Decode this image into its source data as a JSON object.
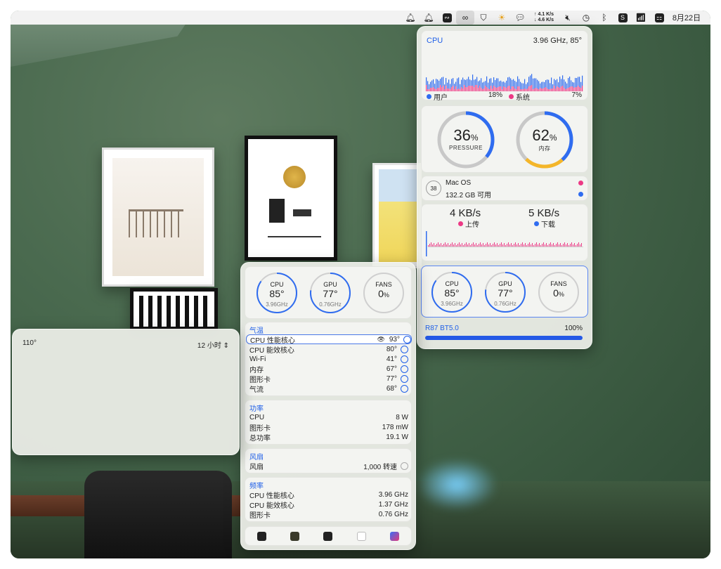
{
  "menubar": {
    "net_up": "4.1 K/s",
    "net_down": "4.6 K/s",
    "date": "8月22日",
    "icons": [
      "bell-icon",
      "bell-icon",
      "stats-app-icon",
      "link-icon",
      "shield-icon",
      "weather-icon",
      "wechat-icon",
      "network-speed",
      "mute-icon",
      "clock-icon",
      "bluetooth-icon",
      "s-app-icon",
      "wifi-icon",
      "control-center-icon"
    ]
  },
  "cpu": {
    "title": "CPU",
    "freq_temp": "3.96 GHz, 85°",
    "user_label": "用户",
    "user_pct": "18%",
    "sys_label": "系统",
    "sys_pct": "7%",
    "colors": {
      "user": "#2f6cf0",
      "system": "#ec3a86"
    }
  },
  "rings": {
    "pressure_value": "36",
    "pressure_label": "PRESSURE",
    "pressure_level": 0.36,
    "memory_value": "62",
    "memory_label": "内存",
    "memory_level": 0.62,
    "pct": "%"
  },
  "disk": {
    "badge": "38",
    "name": "Mac OS",
    "free": "132.2 GB 可用"
  },
  "network": {
    "up_value": "4 KB/s",
    "up_label": "上传",
    "down_value": "5 KB/s",
    "down_label": "下载"
  },
  "gauges": [
    {
      "label": "CPU",
      "value": "85°",
      "sub": "3.96GHz",
      "level": 0.85
    },
    {
      "label": "GPU",
      "value": "77°",
      "sub": "0.76GHz",
      "level": 0.77
    },
    {
      "label": "FANS",
      "value": "0",
      "unit": "%",
      "level": 0.0
    }
  ],
  "battery": {
    "name": "R87 BT5.0",
    "pct": "100%",
    "level": 1.0
  },
  "sensors": {
    "temp_title": "气温",
    "temps": [
      {
        "label": "CPU 性能核心",
        "value": "93°"
      },
      {
        "label": "CPU 能效核心",
        "value": "80°"
      },
      {
        "label": "Wi-Fi",
        "value": "41°"
      },
      {
        "label": "内存",
        "value": "67°"
      },
      {
        "label": "图形卡",
        "value": "77°"
      },
      {
        "label": "气流",
        "value": "68°"
      }
    ],
    "power_title": "功率",
    "power": [
      {
        "label": "CPU",
        "value": "8 W"
      },
      {
        "label": "图形卡",
        "value": "178 mW"
      },
      {
        "label": "总功率",
        "value": "19.1 W"
      }
    ],
    "fan_title": "风扇",
    "fans": [
      {
        "label": "风扇",
        "value": "1,000 转速"
      }
    ],
    "freq_title": "频率",
    "freq": [
      {
        "label": "CPU 性能核心",
        "value": "3.96 GHz"
      },
      {
        "label": "CPU 能效核心",
        "value": "1.37 GHz"
      },
      {
        "label": "图形卡",
        "value": "0.76 GHz"
      }
    ],
    "menu_dots": "⋮"
  },
  "history": {
    "max_label": "110°",
    "range_select": "12 小时"
  },
  "chart_data": {
    "type": "bar",
    "title": "",
    "ylim": [
      0,
      110
    ],
    "values": [
      0,
      0,
      0,
      0,
      0,
      0,
      0,
      0,
      0,
      0,
      0,
      0,
      0,
      0,
      0,
      0,
      0,
      0,
      0,
      0,
      0,
      0,
      0,
      0,
      0,
      0,
      0,
      0,
      0,
      0,
      0,
      0,
      0,
      0,
      0,
      0,
      0,
      0,
      0,
      0,
      0,
      0,
      0,
      0,
      0,
      0,
      0,
      0,
      0,
      0,
      0,
      0,
      0,
      0,
      0,
      0,
      0,
      0,
      0,
      0,
      0,
      0,
      0,
      0,
      0,
      0,
      0,
      0,
      0,
      0,
      0,
      0,
      0,
      0,
      0,
      0,
      0,
      0,
      0,
      0,
      0,
      0,
      0,
      0,
      0,
      0,
      0,
      0,
      0,
      0,
      0,
      0,
      0,
      0,
      0,
      0,
      0,
      0,
      0,
      0,
      0,
      0,
      0,
      0,
      0,
      0,
      0,
      0,
      0,
      0,
      0,
      0,
      0,
      0,
      0,
      0,
      0,
      0,
      0,
      0,
      0,
      0,
      0,
      0,
      0,
      0,
      0,
      0,
      0,
      0,
      0,
      0,
      0,
      0,
      0,
      0,
      0,
      0
    ]
  }
}
